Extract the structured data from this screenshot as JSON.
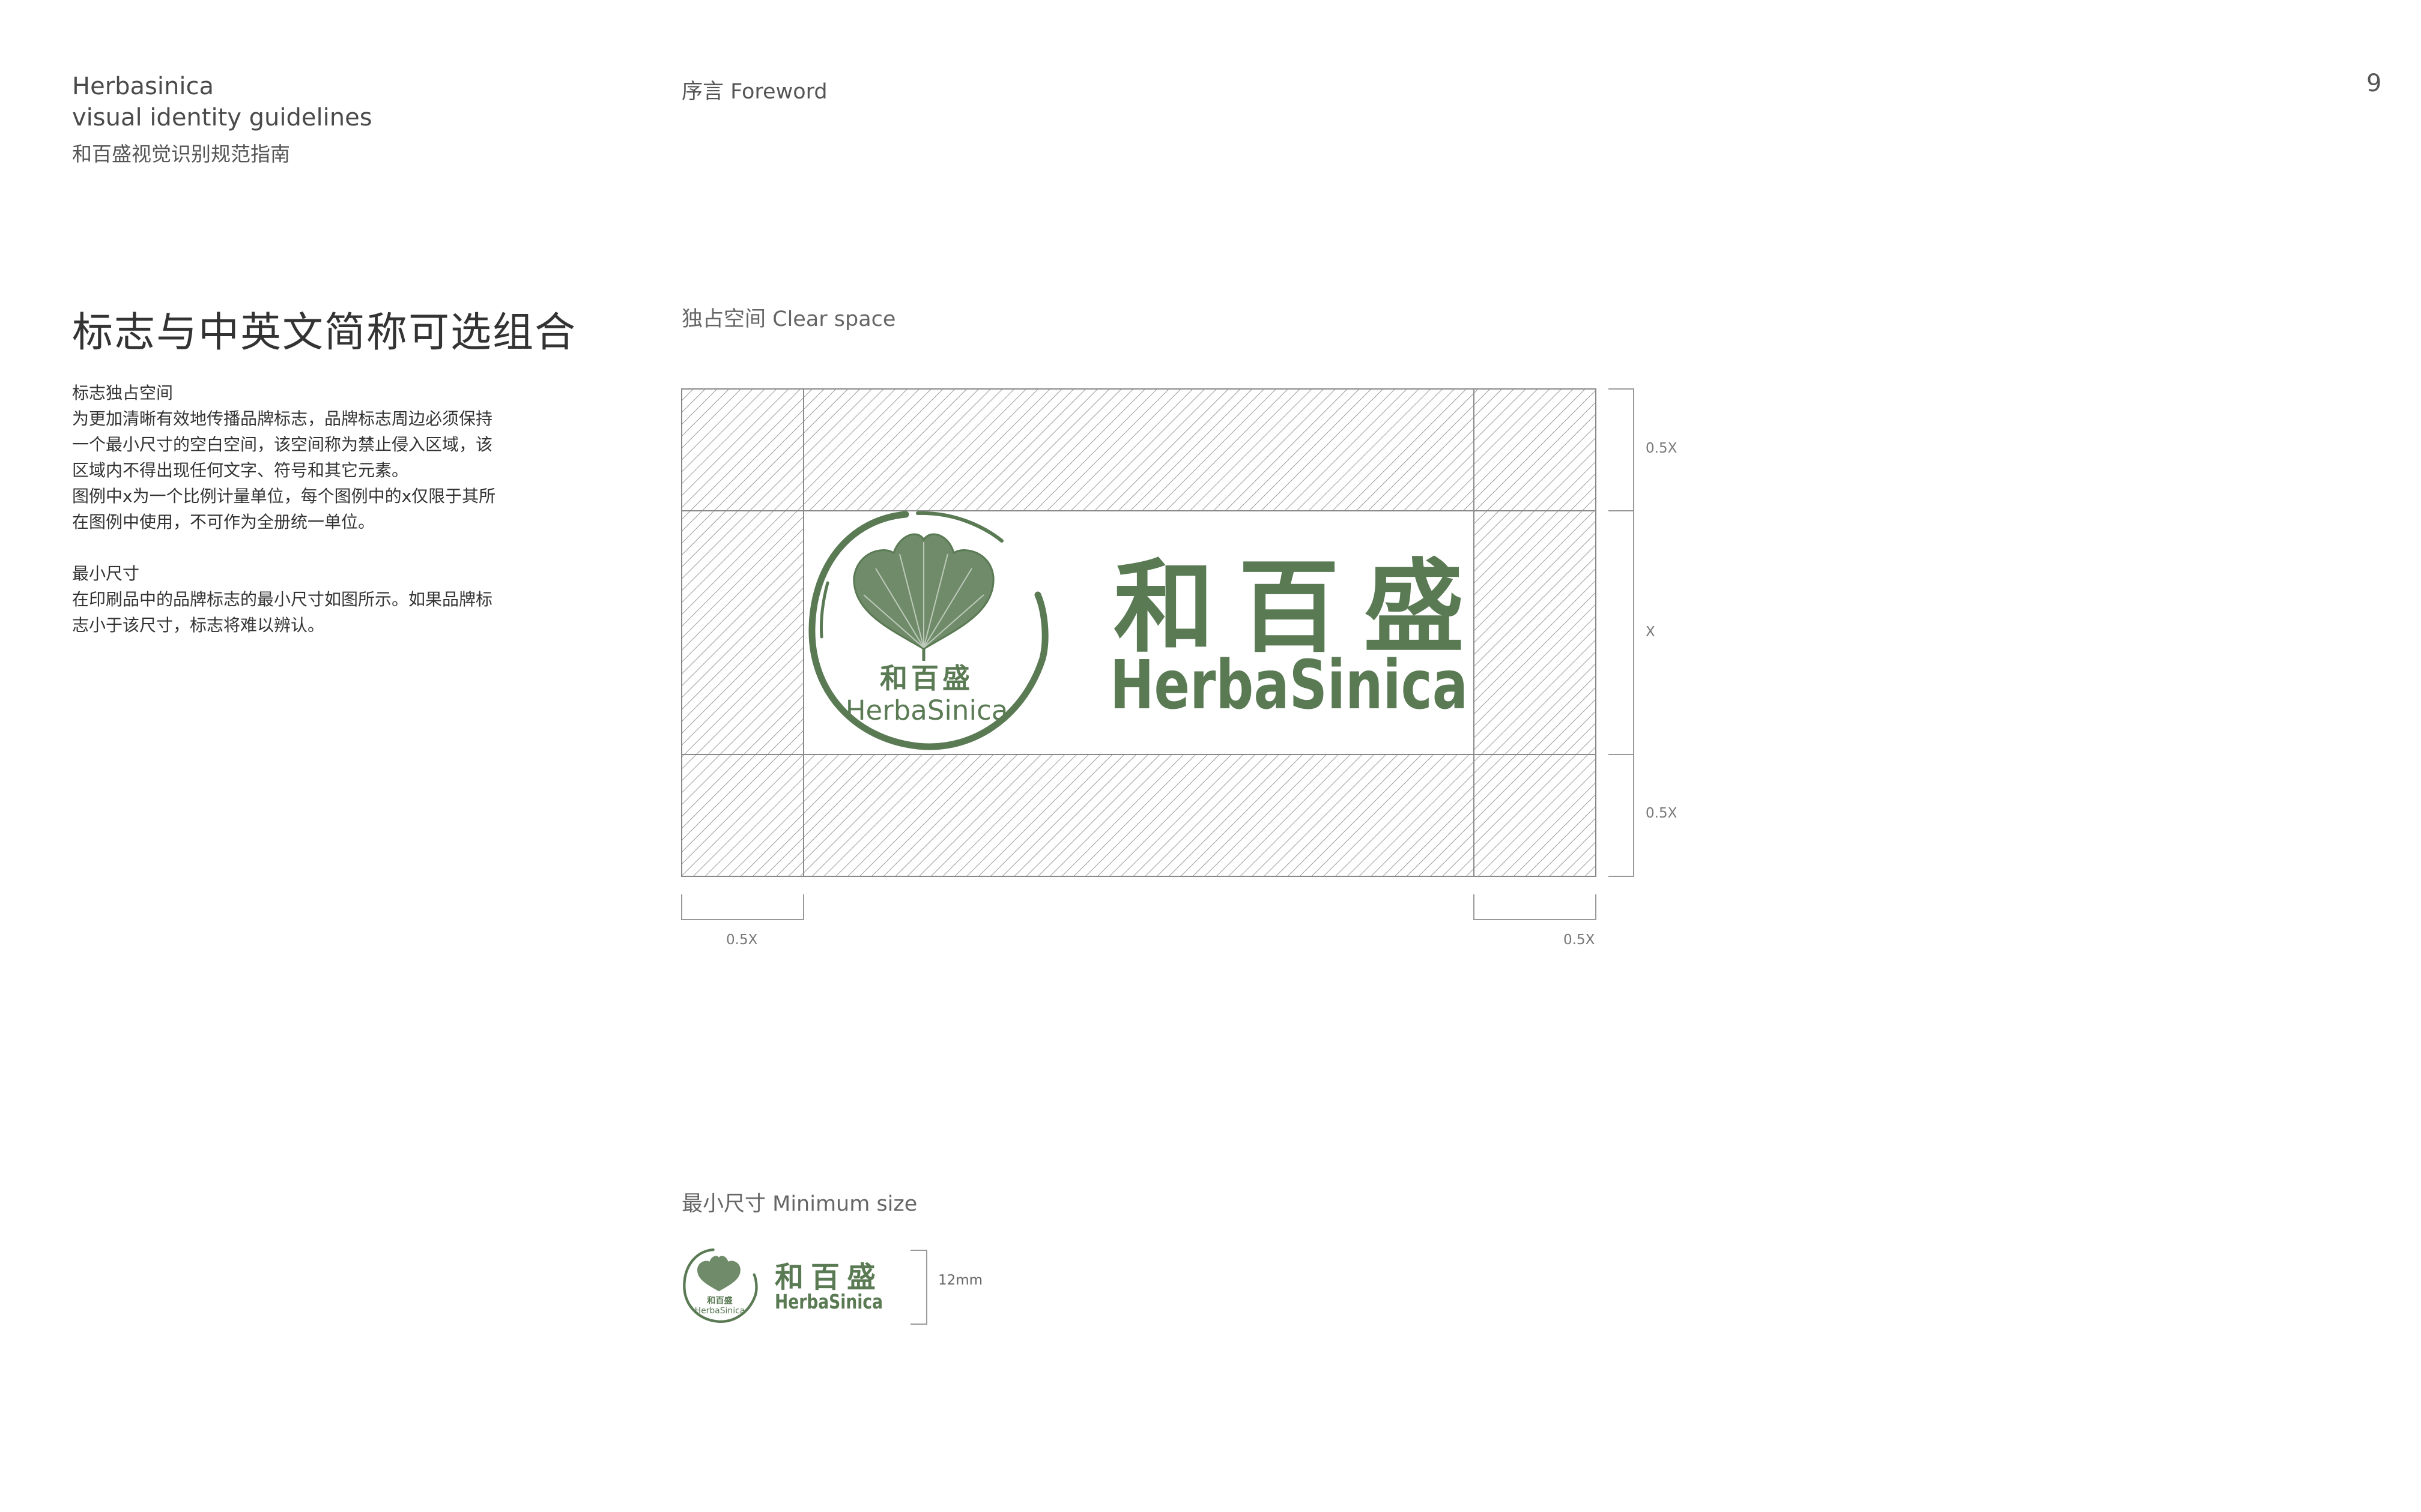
{
  "header": {
    "brand_line1": "Herbasinica",
    "brand_line2": "visual identity guidelines",
    "brand_cn": "和百盛视觉识别规范指南",
    "section": "序言 Foreword",
    "page_number": "9"
  },
  "left": {
    "title": "标志与中英文简称可选组合",
    "clear_space_heading": "标志独占空间",
    "clear_space_lines": [
      "为更加清晰有效地传播品牌标志，品牌标志周边必须保持",
      "一个最小尺寸的空白空间，该空间称为禁止侵入区域，该",
      "区域内不得出现任何文字、符号和其它元素。",
      "图例中x为一个比例计量单位，每个图例中的x仅限于其所",
      "在图例中使用，不可作为全册统一单位。"
    ],
    "min_size_heading": "最小尺寸",
    "min_size_lines": [
      "在印刷品中的品牌标志的最小尺寸如图所示。如果品牌标",
      "志小于该尺寸，标志将难以辨认。"
    ]
  },
  "clear_space": {
    "label": "独占空间 Clear space",
    "dim_top": "0.5X",
    "dim_middle": "X",
    "dim_bottom": "0.5X",
    "dim_left": "0.5X",
    "dim_right": "0.5X"
  },
  "logo": {
    "cn_name": "和百盛",
    "en_name": "HerbaSinica",
    "color": "#5a7a54"
  },
  "min_size": {
    "label": "最小尺寸 Minimum size",
    "dimension": "12mm"
  }
}
